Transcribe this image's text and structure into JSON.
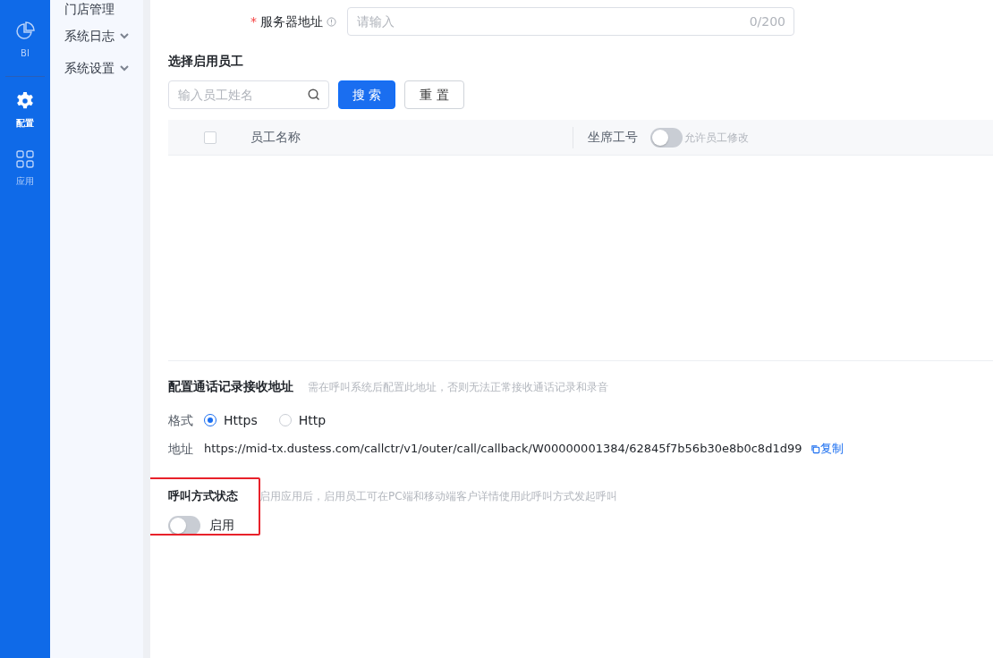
{
  "rail": [
    {
      "label": "BI",
      "selected": false
    },
    {
      "label": "配置",
      "selected": true
    },
    {
      "label": "应用",
      "selected": false
    }
  ],
  "menu": [
    {
      "label": "门店管理",
      "kind": "plain"
    },
    {
      "label": "系统日志",
      "kind": "group"
    },
    {
      "label": "系统设置",
      "kind": "group"
    }
  ],
  "server": {
    "required_mark": "*",
    "label": "服务器地址",
    "placeholder": "请输入",
    "counter": "0/200"
  },
  "staff": {
    "title": "选择启用员工",
    "search_placeholder": "输入员工姓名",
    "search_button": "搜 索",
    "reset_button": "重 置",
    "select_all_checked": false,
    "columns": [
      "员工名称",
      "坐席工号"
    ],
    "allow_edit_on": false,
    "allow_edit_label": "允许员工修改"
  },
  "callback": {
    "title": "配置通话记录接收地址",
    "hint": "需在呼叫系统后配置此地址，否则无法正常接收通话记录和录音",
    "format_label": "格式",
    "formats": [
      {
        "label": "Https",
        "selected": true
      },
      {
        "label": "Http",
        "selected": false
      }
    ],
    "address_label": "地址",
    "address": "https://mid-tx.dustess.com/callctr/v1/outer/call/callback/W00000001384/62845f7b56b30e8b0c8d1d99",
    "copy_label": "复制"
  },
  "status": {
    "title": "呼叫方式状态",
    "hint": "启用应用后，启用员工可在PC端和移动端客户详情使用此呼叫方式发起呼叫",
    "on": false,
    "toggle_label": "启用",
    "highlighted": true
  }
}
